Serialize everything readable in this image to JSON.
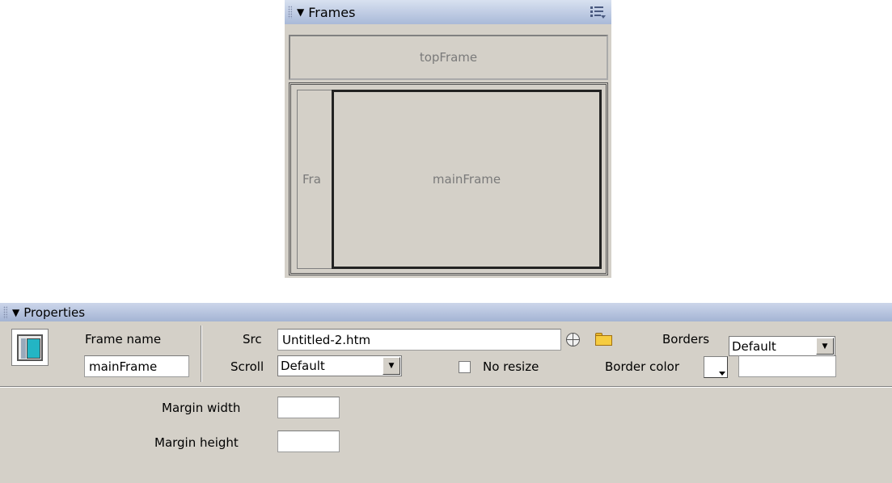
{
  "frames_panel": {
    "title": "Frames",
    "top_frame": "topFrame",
    "left_frame": "Fra",
    "main_frame": "mainFrame"
  },
  "properties": {
    "title": "Properties",
    "frame_name_label": "Frame name",
    "frame_name_value": "mainFrame",
    "src_label": "Src",
    "src_value": "Untitled-2.htm",
    "borders_label": "Borders",
    "borders_value": "Default",
    "scroll_label": "Scroll",
    "scroll_value": "Default",
    "no_resize_label": "No resize",
    "border_color_label": "Border color",
    "margin_width_label": "Margin width",
    "margin_height_label": "Margin height"
  }
}
